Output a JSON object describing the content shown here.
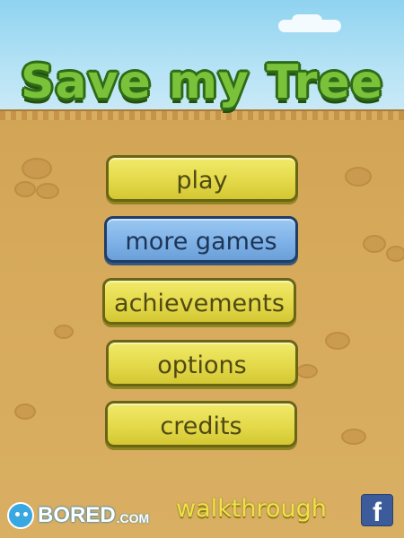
{
  "game": {
    "title": "Save my Tree"
  },
  "menu": {
    "play": "play",
    "more_games": "more games",
    "achievements": "achievements",
    "options": "options",
    "credits": "credits"
  },
  "footer": {
    "logo_main": "BORED",
    "logo_suffix": ".COM",
    "walkthrough": "walkthrough",
    "facebook_icon": "f"
  },
  "colors": {
    "sky": "#8fd3f0",
    "ground": "#d7aa5c",
    "title_fill": "#79c23a",
    "title_outline": "#2f6b17",
    "button_yellow": "#e4d94a",
    "button_blue": "#7fb2e7",
    "facebook": "#3b5b9a"
  },
  "icons": [
    "cloud-icon",
    "bored-face-icon",
    "facebook-icon"
  ]
}
